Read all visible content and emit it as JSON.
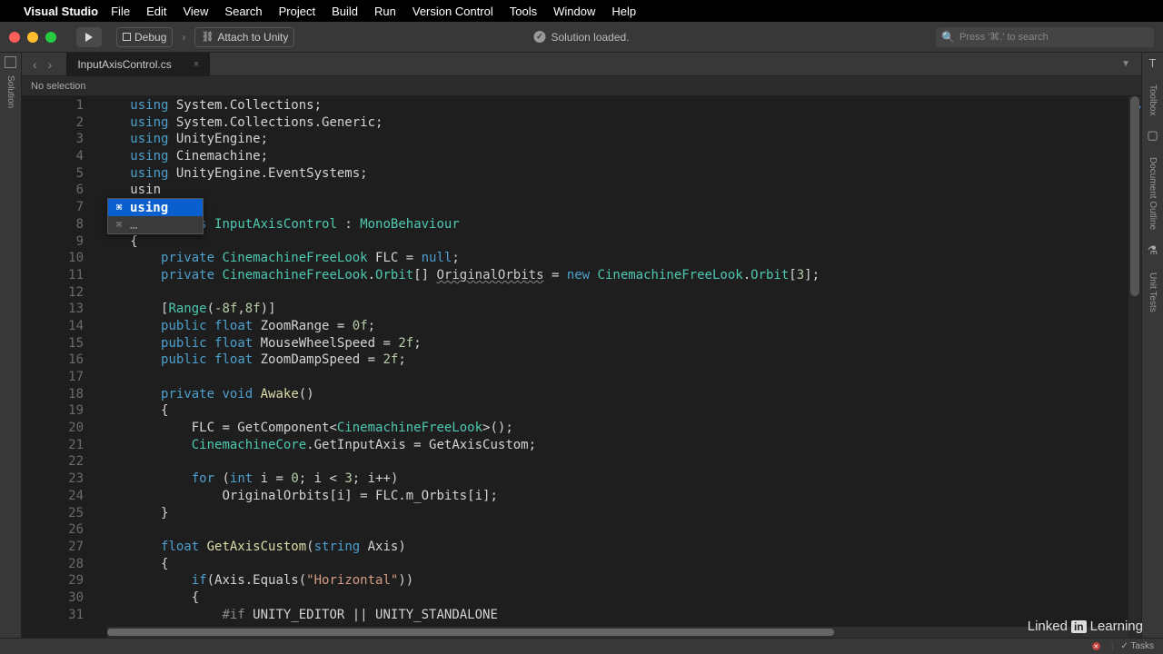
{
  "menubar": {
    "app": "Visual Studio",
    "items": [
      "File",
      "Edit",
      "View",
      "Search",
      "Project",
      "Build",
      "Run",
      "Version Control",
      "Tools",
      "Window",
      "Help"
    ]
  },
  "toolbar": {
    "debug_label": "Debug",
    "attach_label": "Attach to Unity",
    "status": "Solution loaded.",
    "search_placeholder": "Press '⌘.' to search"
  },
  "left_panel": {
    "label": "Solution"
  },
  "right_panel": {
    "labels": [
      "Toolbox",
      "Document Outline",
      "Unit Tests"
    ]
  },
  "tabs": {
    "active": "InputAxisControl.cs",
    "close": "×"
  },
  "breadcrumb": {
    "text": "No selection"
  },
  "autocomplete": {
    "items": [
      {
        "sym": "⌘",
        "txt": "using",
        "selected": true
      },
      {
        "sym": "⌘",
        "txt": "…",
        "selected": false
      }
    ]
  },
  "bottom": {
    "errors": "",
    "tasks": "Tasks"
  },
  "brand": {
    "prefix": "Linked",
    "box": "in",
    "suffix": "Learning"
  },
  "code": {
    "lines": [
      [
        [
          "kw",
          "using "
        ],
        [
          "plain",
          "System.Collections;"
        ]
      ],
      [
        [
          "kw",
          "using "
        ],
        [
          "plain",
          "System.Collections.Generic;"
        ]
      ],
      [
        [
          "kw",
          "using "
        ],
        [
          "plain",
          "UnityEngine;"
        ]
      ],
      [
        [
          "kw",
          "using "
        ],
        [
          "plain",
          "Cinemachine;"
        ]
      ],
      [
        [
          "kw",
          "using "
        ],
        [
          "plain",
          "UnityEngine.EventSystems;"
        ]
      ],
      [
        [
          "plain",
          "usin"
        ]
      ],
      [
        [
          "plain",
          ""
        ]
      ],
      [
        [
          "plain",
          "       "
        ],
        [
          "kw",
          "ass "
        ],
        [
          "type",
          "InputAxisControl"
        ],
        [
          "plain",
          " : "
        ],
        [
          "type",
          "MonoBehaviour"
        ]
      ],
      [
        [
          "plain",
          "{"
        ]
      ],
      [
        [
          "plain",
          "    "
        ],
        [
          "kw",
          "private "
        ],
        [
          "type",
          "CinemachineFreeLook"
        ],
        [
          "plain",
          " FLC = "
        ],
        [
          "kw",
          "null"
        ],
        [
          "plain",
          ";"
        ]
      ],
      [
        [
          "plain",
          "    "
        ],
        [
          "kw",
          "private "
        ],
        [
          "type",
          "CinemachineFreeLook"
        ],
        [
          "plain",
          "."
        ],
        [
          "type",
          "Orbit"
        ],
        [
          "plain",
          "[] "
        ],
        [
          "underline",
          "OriginalOrbits"
        ],
        [
          "plain",
          " = "
        ],
        [
          "kw",
          "new "
        ],
        [
          "type",
          "CinemachineFreeLook"
        ],
        [
          "plain",
          "."
        ],
        [
          "type",
          "Orbit"
        ],
        [
          "plain",
          "["
        ],
        [
          "num",
          "3"
        ],
        [
          "plain",
          "];"
        ]
      ],
      [
        [
          "plain",
          ""
        ]
      ],
      [
        [
          "plain",
          "    ["
        ],
        [
          "attr",
          "Range"
        ],
        [
          "plain",
          "("
        ],
        [
          "num",
          "-8f"
        ],
        [
          "plain",
          ","
        ],
        [
          "num",
          "8f"
        ],
        [
          "plain",
          ")]"
        ]
      ],
      [
        [
          "plain",
          "    "
        ],
        [
          "kw",
          "public "
        ],
        [
          "kw",
          "float "
        ],
        [
          "plain",
          "ZoomRange = "
        ],
        [
          "num",
          "0f"
        ],
        [
          "plain",
          ";"
        ]
      ],
      [
        [
          "plain",
          "    "
        ],
        [
          "kw",
          "public "
        ],
        [
          "kw",
          "float "
        ],
        [
          "plain",
          "MouseWheelSpeed = "
        ],
        [
          "num",
          "2f"
        ],
        [
          "plain",
          ";"
        ]
      ],
      [
        [
          "plain",
          "    "
        ],
        [
          "kw",
          "public "
        ],
        [
          "kw",
          "float "
        ],
        [
          "plain",
          "ZoomDampSpeed = "
        ],
        [
          "num",
          "2f"
        ],
        [
          "plain",
          ";"
        ]
      ],
      [
        [
          "plain",
          ""
        ]
      ],
      [
        [
          "plain",
          "    "
        ],
        [
          "kw",
          "private "
        ],
        [
          "kw",
          "void "
        ],
        [
          "fn",
          "Awake"
        ],
        [
          "plain",
          "()"
        ]
      ],
      [
        [
          "plain",
          "    {"
        ]
      ],
      [
        [
          "plain",
          "        FLC = GetComponent<"
        ],
        [
          "type",
          "CinemachineFreeLook"
        ],
        [
          "plain",
          ">();"
        ]
      ],
      [
        [
          "plain",
          "        "
        ],
        [
          "type",
          "CinemachineCore"
        ],
        [
          "plain",
          ".GetInputAxis = GetAxisCustom;"
        ]
      ],
      [
        [
          "plain",
          ""
        ]
      ],
      [
        [
          "plain",
          "        "
        ],
        [
          "kw",
          "for "
        ],
        [
          "plain",
          "("
        ],
        [
          "kw",
          "int"
        ],
        [
          "plain",
          " i = "
        ],
        [
          "num",
          "0"
        ],
        [
          "plain",
          "; i < "
        ],
        [
          "num",
          "3"
        ],
        [
          "plain",
          "; i++)"
        ]
      ],
      [
        [
          "plain",
          "            OriginalOrbits[i] = FLC.m_Orbits[i];"
        ]
      ],
      [
        [
          "plain",
          "    }"
        ]
      ],
      [
        [
          "plain",
          ""
        ]
      ],
      [
        [
          "plain",
          "    "
        ],
        [
          "kw",
          "float "
        ],
        [
          "fn",
          "GetAxisCustom"
        ],
        [
          "plain",
          "("
        ],
        [
          "kw",
          "string"
        ],
        [
          "plain",
          " Axis)"
        ]
      ],
      [
        [
          "plain",
          "    {"
        ]
      ],
      [
        [
          "plain",
          "        "
        ],
        [
          "kw",
          "if"
        ],
        [
          "plain",
          "(Axis.Equals("
        ],
        [
          "str",
          "\"Horizontal\""
        ],
        [
          "plain",
          "))"
        ]
      ],
      [
        [
          "plain",
          "        {"
        ]
      ],
      [
        [
          "plain",
          "            "
        ],
        [
          "preproc",
          "#if"
        ],
        [
          "plain",
          " UNITY_EDITOR || UNITY_STANDALONE"
        ]
      ]
    ]
  }
}
